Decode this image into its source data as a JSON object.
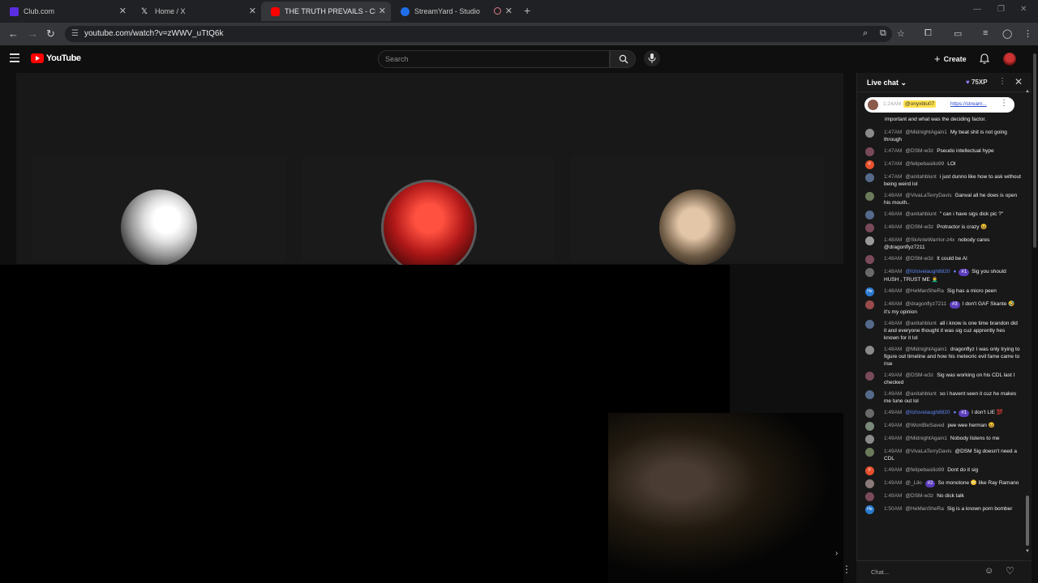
{
  "browser": {
    "tabs": [
      {
        "title": "Club.com",
        "color": "#5a2de0"
      },
      {
        "title": "Home / X",
        "color": "#000000"
      },
      {
        "title": "THE TRUTH PREVAILS - CRYSTA",
        "color": "#ff0000"
      },
      {
        "title": "StreamYard - Studio",
        "color": "#1f6feb"
      }
    ],
    "url": "youtube.com/watch?v=zWWV_uTtQ6k"
  },
  "youtube": {
    "logo_text": "YouTube",
    "search_placeholder": "Search",
    "create_label": "Create"
  },
  "chat": {
    "title": "Live chat",
    "xp": "75XP",
    "pinned": {
      "time": "1:24AM",
      "handle": "@onyxblu07",
      "link": "https://stream..."
    },
    "pinned_continuation": "important and what was the deciding factor.",
    "input_placeholder": "Chat...",
    "messages": [
      {
        "time": "1:47AM",
        "author": "@MidnightAgain1",
        "text": "My beat shit is not going through",
        "av": "#8a8a8a"
      },
      {
        "time": "1:47AM",
        "author": "@DSM-w3z",
        "text": "Pseudo intellectual hype",
        "av": "#7a4a5a"
      },
      {
        "time": "1:47AM",
        "author": "@felipebasilio99",
        "text": "LOl",
        "av": "#e8502e",
        "letter": "F"
      },
      {
        "time": "1:47AM",
        "author": "@anitahblunt",
        "text": "i just dunno like how to ask without being weird lol",
        "av": "#556a8a"
      },
      {
        "time": "1:48AM",
        "author": "@VivaLaTerryDavis",
        "text": "Ganval all he does is open his mouth..",
        "av": "#6a7a5a"
      },
      {
        "time": "1:48AM",
        "author": "@anitahblunt",
        "text": "\" can i have sigs dick pic ?\"",
        "av": "#556a8a"
      },
      {
        "time": "1:48AM",
        "author": "@DSM-w3z",
        "text": "Protractor is crazy 😆",
        "av": "#7a4a5a"
      },
      {
        "time": "1:48AM",
        "author": "@SkAnteWarrior-z4x",
        "text": "nobody cares @dragonflyz7211",
        "av": "#9a9a9a"
      },
      {
        "time": "1:48AM",
        "author": "@DSM-w3z",
        "text": "It could be AI",
        "av": "#7a4a5a"
      },
      {
        "time": "1:48AM",
        "author": "@lizlovelaugh8820",
        "mod": true,
        "badge": "#1",
        "text": "Sig you should HUSH , TRUST ME 🤦‍♂️",
        "av": "#6a6a6a"
      },
      {
        "time": "1:48AM",
        "author": "@HeManSheRa",
        "text": "Sig has a micro peen",
        "av": "#2a7ad0",
        "letter": "He"
      },
      {
        "time": "1:48AM",
        "author": "@dragonflyz7211",
        "badge": "#3",
        "text": "I don't GAF Skante 🤣 it's my opinion",
        "av": "#9a4a4a"
      },
      {
        "time": "1:48AM",
        "author": "@anitahblunt",
        "text": "all i know is one time brandon did it and everyone thought it was sig cuz apprently hes known for it lol",
        "av": "#556a8a"
      },
      {
        "time": "1:48AM",
        "author": "@MidnightAgain1",
        "text": "dragonflyz I was only trying to figure out timeline and how his meteoric evil fame came to rise",
        "av": "#8a8a8a"
      },
      {
        "time": "1:49AM",
        "author": "@DSM-w3z",
        "text": "Sig was working on his CDL last I checked",
        "av": "#7a4a5a"
      },
      {
        "time": "1:49AM",
        "author": "@anitahblunt",
        "text": "so i havent seen it cuz he makes me tune out lol",
        "av": "#556a8a"
      },
      {
        "time": "1:49AM",
        "author": "@lizlovelaugh8820",
        "mod": true,
        "badge": "#1",
        "text": "I don't LIE 💯",
        "av": "#6a6a6a"
      },
      {
        "time": "1:49AM",
        "author": "@WontBeSaved",
        "text": "pee wee herman 😆",
        "av": "#7a8a7a"
      },
      {
        "time": "1:49AM",
        "author": "@MidnightAgain1",
        "text": "Nobody listens to me",
        "av": "#8a8a8a"
      },
      {
        "time": "1:49AM",
        "author": "@VivaLaTerryDavis",
        "text": "@DSM Sig doesn't need a CDL",
        "av": "#6a7a5a"
      },
      {
        "time": "1:49AM",
        "author": "@felipebasilio99",
        "text": "Dont do it sig",
        "av": "#e8502e",
        "letter": "F"
      },
      {
        "time": "1:49AM",
        "author": "@_Lilo",
        "badge": "#2",
        "text": "So monotone 😳 like Ray Ramano",
        "av": "#8a7a7a"
      },
      {
        "time": "1:49AM",
        "author": "@DSM-w3z",
        "text": "No dick talk",
        "av": "#7a4a5a"
      },
      {
        "time": "1:50AM",
        "author": "@HeManSheRa",
        "text": "Sig is a known porn bomber",
        "av": "#2a7ad0",
        "letter": "He"
      }
    ]
  }
}
